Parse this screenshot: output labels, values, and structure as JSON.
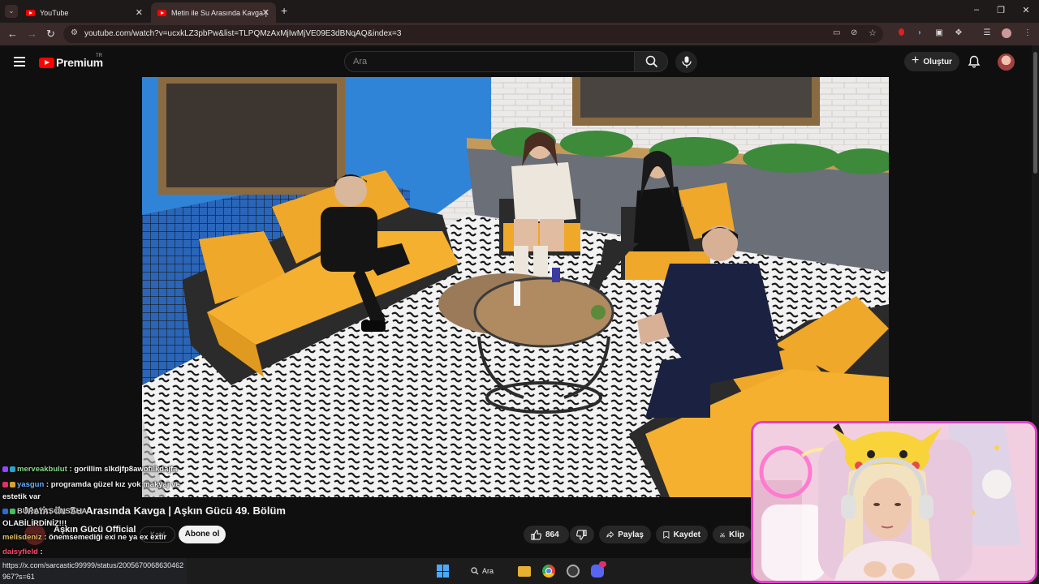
{
  "browser": {
    "tabs": [
      {
        "title": "YouTube",
        "active": false
      },
      {
        "title": "Metin ile Su Arasında Kavga | A",
        "active": true
      }
    ],
    "url": "youtube.com/watch?v=ucxkLZ3pbPw&list=TLPQMzAxMjIwMjVE09E3dBNqAQ&index=3"
  },
  "header": {
    "logo_text": "Premium",
    "logo_region": "TR",
    "search_placeholder": "Ara",
    "create_label": "Oluştur"
  },
  "video": {
    "title": "Metin ile Su Arasında Kavga | Aşkın Gücü 49. Bölüm",
    "channel": "Aşkın Gücü Official",
    "subscribers": "",
    "join_label": "Katıl",
    "subscribe_label": "Abone ol",
    "like_count": "864",
    "share_label": "Paylaş",
    "save_label": "Kaydet",
    "clip_label": "Klip"
  },
  "chat": [
    {
      "user": "merveakbulut",
      "message": ": gorillim slkdjfp8awofılkdajfa"
    },
    {
      "user": "yasgun",
      "message": ": programda güzel kız yok makyaj ve"
    },
    {
      "user": "",
      "message": "estetik var"
    },
    {
      "user": "BURAYASÖNSAHA",
      "message": ""
    },
    {
      "user": "",
      "message": "OLABİLİRDİNİZ!!!"
    },
    {
      "user": "melisdeniz",
      "message": ": önemsemediği exi ne ya ex extir"
    },
    {
      "user": "daisyfield",
      "message": ":"
    }
  ],
  "status_link": "https://x.com/sarcastic99999/status/2005670068630462967?s=61",
  "taskbar": {
    "search_label": "Ara"
  },
  "colors": {
    "accent": "#ff0000",
    "webcam_border": "#e040c8",
    "sofa": "#f0a82a"
  }
}
